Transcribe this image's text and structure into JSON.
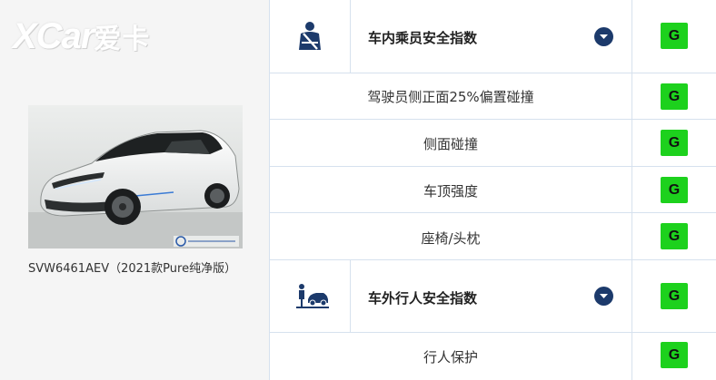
{
  "watermark": {
    "brand_latin": "XCar",
    "brand_cn": "爱卡"
  },
  "vehicle": {
    "caption": "SVW6461AEV（2021款Pure纯净版）"
  },
  "sections": [
    {
      "title": "车内乘员安全指数",
      "icon": "seatbelt-occupant-icon",
      "rating": "G",
      "tests": [
        {
          "label": "驾驶员侧正面25%偏置碰撞",
          "rating": "G"
        },
        {
          "label": "侧面碰撞",
          "rating": "G"
        },
        {
          "label": "车顶强度",
          "rating": "G"
        },
        {
          "label": "座椅/头枕",
          "rating": "G"
        }
      ]
    },
    {
      "title": "车外行人安全指数",
      "icon": "pedestrian-car-icon",
      "rating": "G",
      "tests": [
        {
          "label": "行人保护",
          "rating": "G"
        }
      ]
    }
  ],
  "colors": {
    "rating_good": "#1dd11d",
    "accent_navy": "#1c3a6b",
    "grid_line": "#d6e1ee"
  }
}
